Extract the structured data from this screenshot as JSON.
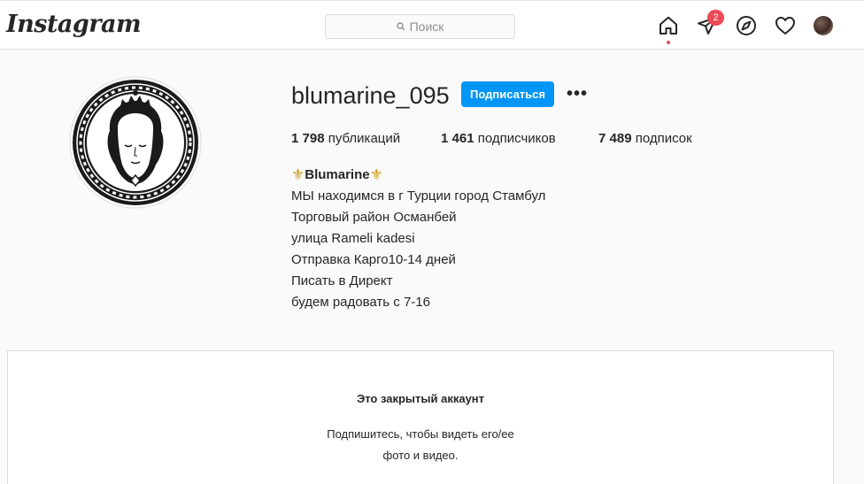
{
  "header": {
    "logo": "Instagram",
    "search_placeholder": "Поиск",
    "direct_badge": "2",
    "icons": [
      "home-icon",
      "direct-icon",
      "explore-icon",
      "heart-icon",
      "avatar"
    ],
    "accent_color": "#ed4956"
  },
  "profile": {
    "username": "blumarine_095",
    "follow_label": "Подписаться",
    "more_label": "•••",
    "stats": [
      {
        "count": "1 798",
        "label": "публикаций"
      },
      {
        "count": "1 461",
        "label": "подписчиков"
      },
      {
        "count": "7 489",
        "label": "подписок"
      }
    ],
    "bio": {
      "fleur_left": "⚜",
      "name": "Blumarine",
      "fleur_right": "⚜",
      "lines": [
        "МЫ находимся в г Турции город Стамбул",
        "Торговый район Османбей",
        "улица Rameli kadesi",
        "Отправка Карго10-14 дней",
        "Писать в Директ",
        "будем радовать с 7-16"
      ]
    },
    "button_color": "#0095f6"
  },
  "private": {
    "title": "Это закрытый аккаунт",
    "line1": "Подпишитесь, чтобы видеть его/ее",
    "line2": "фото и видео."
  }
}
